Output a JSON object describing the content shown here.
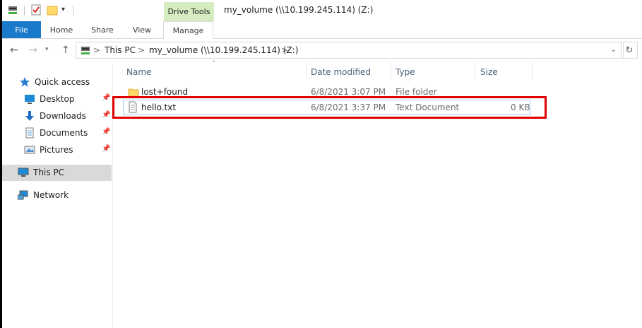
{
  "window": {
    "title": "my_volume (\\\\10.199.245.114) (Z:)",
    "context_tab": "Drive Tools"
  },
  "ribbon": {
    "tabs": [
      {
        "label": "File"
      },
      {
        "label": "Home"
      },
      {
        "label": "Share"
      },
      {
        "label": "View"
      },
      {
        "label": "Manage"
      }
    ]
  },
  "address_bar": {
    "segments": [
      "This PC",
      "my_volume (\\\\10.199.245.114) (Z:)"
    ],
    "separator": ">"
  },
  "sidebar": {
    "items": [
      {
        "label": "Quick access",
        "icon": "star-icon"
      },
      {
        "label": "Desktop",
        "icon": "desktop-icon",
        "pinned": true
      },
      {
        "label": "Downloads",
        "icon": "download-icon",
        "pinned": true
      },
      {
        "label": "Documents",
        "icon": "documents-icon",
        "pinned": true
      },
      {
        "label": "Pictures",
        "icon": "pictures-icon",
        "pinned": true
      },
      {
        "label": "This PC",
        "icon": "computer-icon",
        "selected": true
      },
      {
        "label": "Network",
        "icon": "network-icon"
      }
    ]
  },
  "file_list": {
    "columns": [
      "Name",
      "Date modified",
      "Type",
      "Size"
    ],
    "rows": [
      {
        "name": "lost+found",
        "date": "6/8/2021 3:07 PM",
        "type": "File folder",
        "size": "",
        "icon": "folder-icon"
      },
      {
        "name": "hello.txt",
        "date": "6/8/2021 3:37 PM",
        "type": "Text Document",
        "size": "0 KB",
        "icon": "text-file-icon",
        "highlighted": true
      }
    ]
  },
  "colors": {
    "file_tab": "#1979ca",
    "drive_tools_bg": "#d5ecc0",
    "highlight_border": "#e00000",
    "selection_bg": "#d9d9d9"
  }
}
